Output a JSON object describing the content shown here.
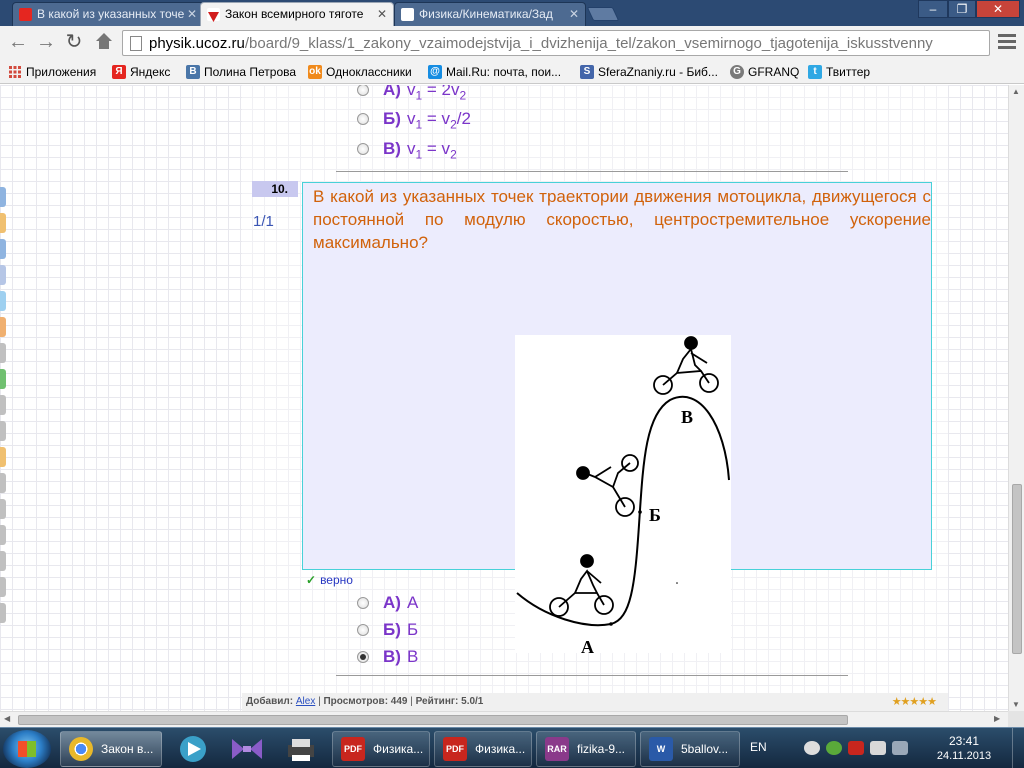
{
  "browser": {
    "tabs": [
      {
        "label": "В какой из указанных точе",
        "icon": "yandex-icon",
        "active": false
      },
      {
        "label": "Закон всемирного тяготе",
        "icon": "ucoz-icon",
        "active": true
      },
      {
        "label": "Физика/Кинематика/Зад",
        "icon": "page-icon",
        "active": false
      }
    ],
    "url_host": "physik.ucoz.ru",
    "url_path": "/board/9_klass/1_zakony_vzaimodejstvija_i_dvizhenija_tel/zakon_vsemirnogo_tjagotenija_iskusstvenny"
  },
  "bookmarks": [
    {
      "label": "Приложения",
      "icon": "apps-grid-icon",
      "color": "#d24b3e"
    },
    {
      "label": "Яндекс",
      "icon": "yandex-icon",
      "color": "#e52620",
      "glyph": "Я"
    },
    {
      "label": "Полина Петрова",
      "icon": "vk-icon",
      "color": "#4a76a8",
      "glyph": "B"
    },
    {
      "label": "Одноклассники",
      "icon": "odnoklassniki-icon",
      "color": "#f08a1c",
      "glyph": "ok"
    },
    {
      "label": "Mail.Ru: почта, пои...",
      "icon": "mailru-icon",
      "color": "#168de2",
      "glyph": "@"
    },
    {
      "label": "SferaZnaniy.ru - Биб...",
      "icon": "sfera-icon",
      "color": "#4466aa",
      "glyph": "S"
    },
    {
      "label": "GFRANQ",
      "icon": "gfranq-icon",
      "color": "#7a7a7a",
      "glyph": "G"
    },
    {
      "label": "Твиттер",
      "icon": "twitter-icon",
      "color": "#2fa8e4",
      "glyph": "t"
    }
  ],
  "prev_question": {
    "options": [
      {
        "letter": "А)",
        "text_html": "v<sub>1</sub> = 2v<sub>2</sub>"
      },
      {
        "letter": "Б)",
        "text_html": "v<sub>1</sub> = v<sub>2</sub>/2"
      },
      {
        "letter": "В)",
        "text_html": "v<sub>1</sub> = v<sub>2</sub>"
      }
    ]
  },
  "question": {
    "number": "10.",
    "score": "1/1",
    "text": "В какой из указанных точек траектории движения мотоцикла, движущегося с постоянной по модулю скоростью, центростремительное ускорение максимально?",
    "figure_labels": {
      "A": "А",
      "B": "Б",
      "C": "В"
    },
    "verdict": "верно",
    "options": [
      {
        "letter": "А)",
        "text": "А",
        "selected": false
      },
      {
        "letter": "Б)",
        "text": "Б",
        "selected": false
      },
      {
        "letter": "В)",
        "text": "В",
        "selected": true
      }
    ]
  },
  "footer": {
    "added_label": "Добавил:",
    "author": "Alex",
    "views": "Просмотров: 449",
    "rating": "Рейтинг: 5.0/1",
    "stars": "★★★★★"
  },
  "taskbar": {
    "tasks": [
      {
        "label": "Закон в...",
        "icon": "chrome-icon",
        "color": "#e8b82a",
        "glyph": ""
      },
      {
        "label": "Физика...",
        "icon": "pdf-icon",
        "color": "#c8261e",
        "glyph": "PDF"
      },
      {
        "label": "Физика...",
        "icon": "pdf-icon",
        "color": "#c8261e",
        "glyph": "PDF"
      },
      {
        "label": "fizika-9...",
        "icon": "winrar-icon",
        "color": "#8a3a8a",
        "glyph": "RAR"
      },
      {
        "label": "5ballov...",
        "icon": "word-icon",
        "color": "#2a5aa8",
        "glyph": "W"
      }
    ],
    "lang": "EN",
    "time": "23:41",
    "date": "24.11.2013"
  }
}
